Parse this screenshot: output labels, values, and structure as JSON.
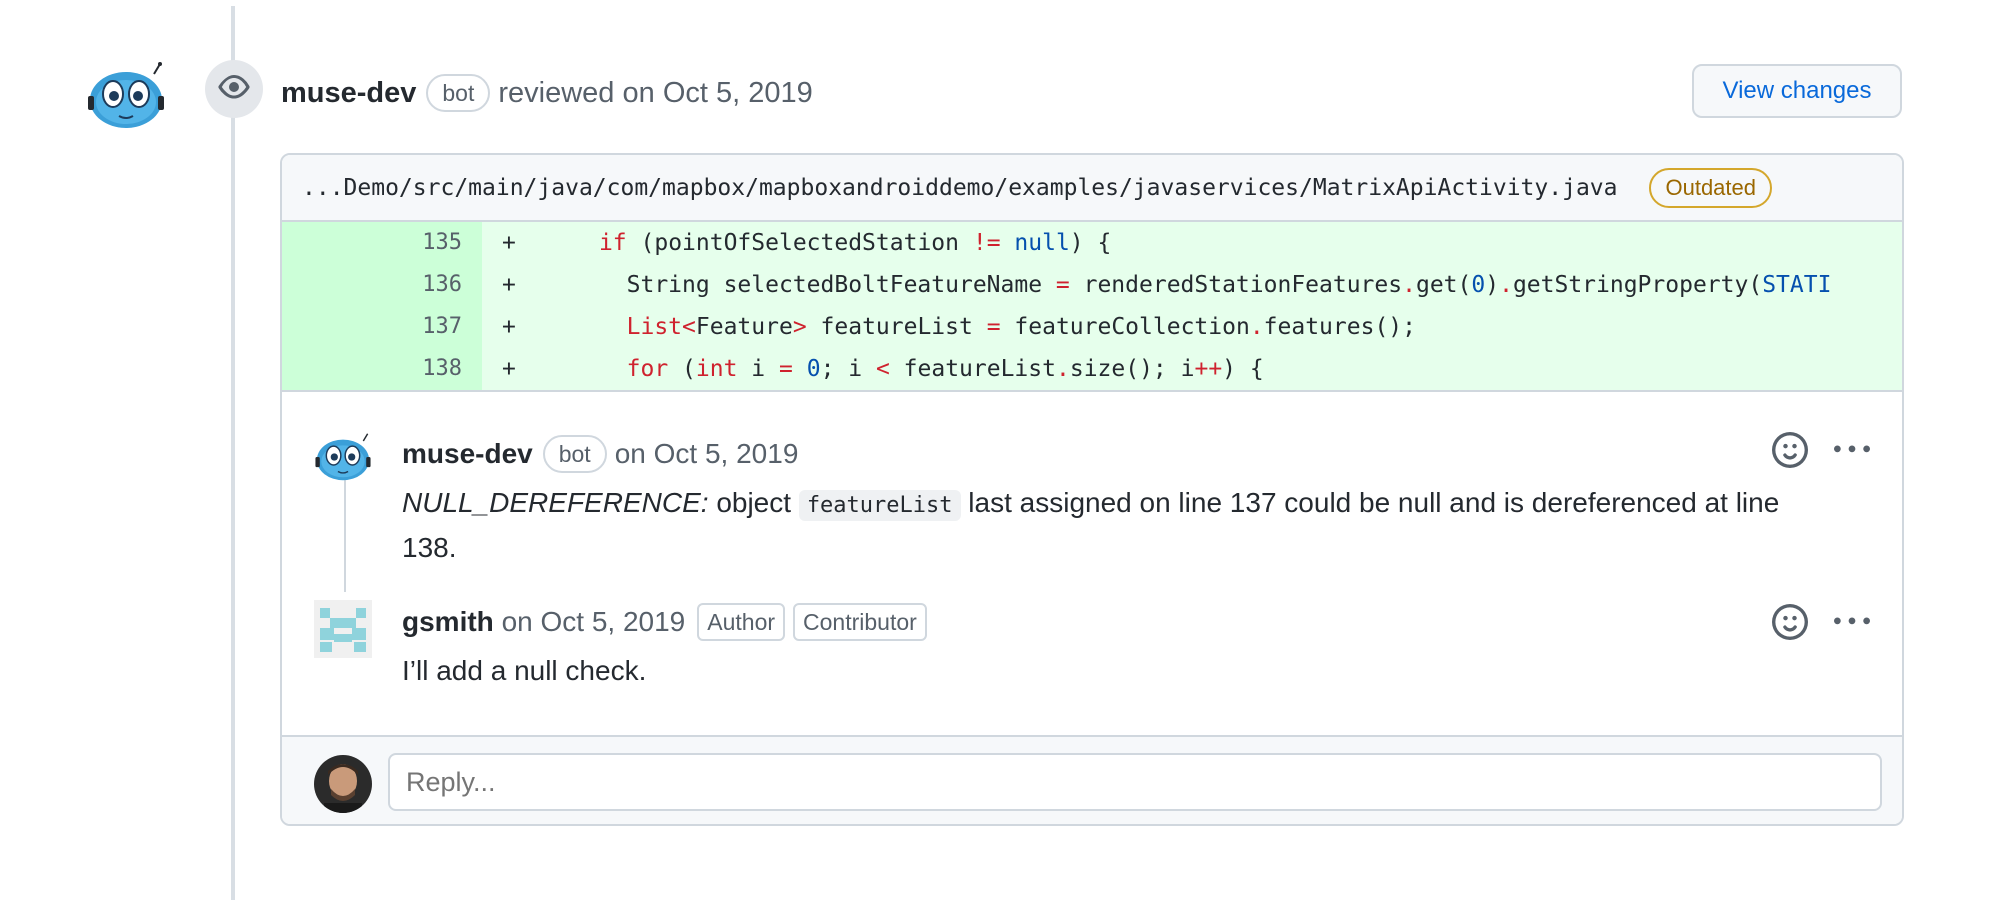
{
  "review": {
    "author": "muse-dev",
    "bot_label": "bot",
    "action_text": "reviewed",
    "date_text": "on Oct 5, 2019",
    "view_changes_label": "View changes"
  },
  "file": {
    "path": "...Demo/src/main/java/com/mapbox/mapboxandroiddemo/examples/javaservices/MatrixApiActivity.java",
    "status_label": "Outdated"
  },
  "diff": {
    "lines": [
      {
        "number": "135",
        "sign": "+",
        "code": "      if (pointOfSelectedStation != null) {"
      },
      {
        "number": "136",
        "sign": "+",
        "code": "        String selectedBoltFeatureName = renderedStationFeatures.get(0).getStringProperty(STATI"
      },
      {
        "number": "137",
        "sign": "+",
        "code": "        List<Feature> featureList = featureCollection.features();"
      },
      {
        "number": "138",
        "sign": "+",
        "code": "        for (int i = 0; i < featureList.size(); i++) {"
      }
    ]
  },
  "comments": [
    {
      "author": "muse-dev",
      "bot_label": "bot",
      "date_text": "on Oct 5, 2019",
      "body_type": "NULL_DEREFERENCE:",
      "body_pre": "object",
      "body_code": "featureList",
      "body_post": "last assigned on line 137 could be null and is dereferenced at line 138."
    },
    {
      "author": "gsmith",
      "date_text": "on Oct 5, 2019",
      "labels": [
        "Author",
        "Contributor"
      ],
      "body": "I’ll add a null check."
    }
  ],
  "reply": {
    "placeholder": "Reply..."
  },
  "icons": {
    "review_state": "eye-icon",
    "reaction": "smiley-icon",
    "more": "kebab-horizontal-icon"
  },
  "colors": {
    "link": "#0969da",
    "added_bg": "#e6ffec",
    "added_gutter": "#ccffd8",
    "outdated": "#9a6700"
  }
}
